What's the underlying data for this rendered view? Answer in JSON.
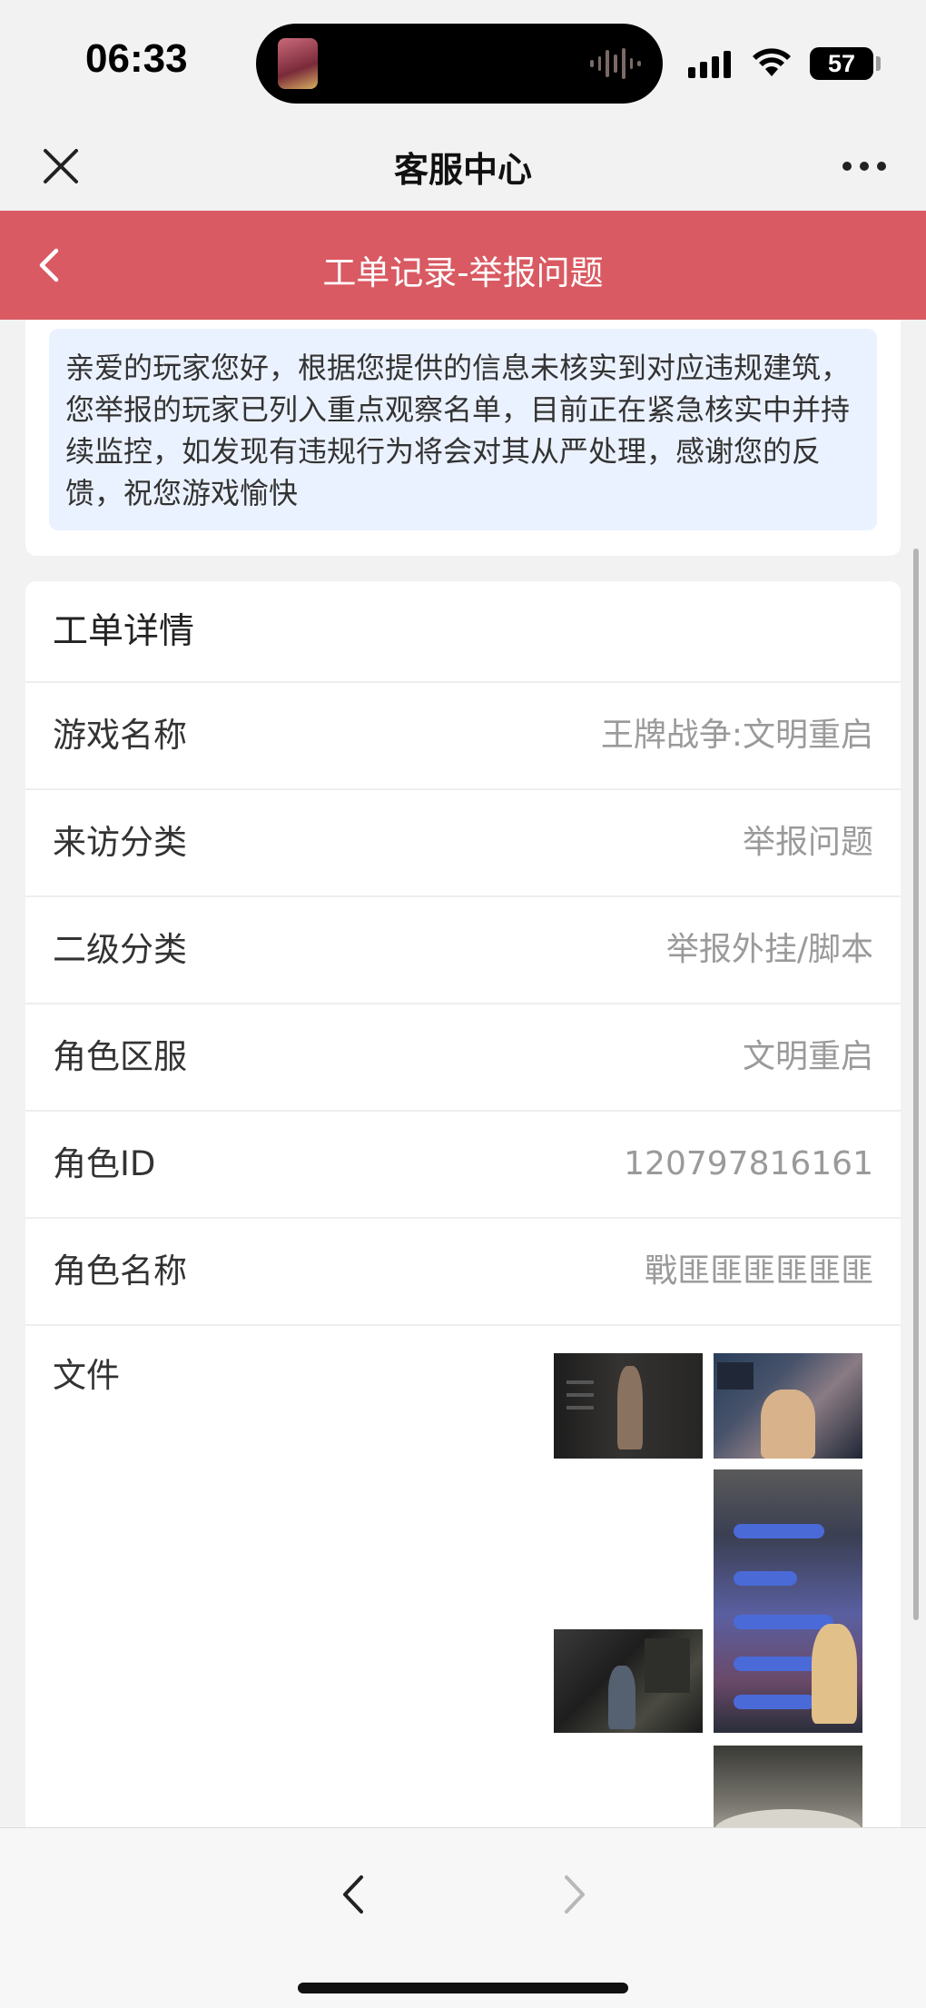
{
  "status_bar": {
    "time": "06:33",
    "battery": "57"
  },
  "wechat_nav": {
    "title": "客服中心",
    "close_icon": "close-icon",
    "more_icon": "more-dots-icon"
  },
  "header": {
    "title": "工单记录-举报问题",
    "back_icon": "chevron-left-icon",
    "color": "#d95a62"
  },
  "reply": {
    "text": "亲爱的玩家您好，根据您提供的信息未核实到对应违规建筑，您举报的玩家已列入重点观察名单，目前正在紧急核实中并持续监控，如发现有违规行为将会对其从严处理，感谢您的反馈，祝您游戏愉快"
  },
  "details": {
    "title": "工单详情",
    "rows": [
      {
        "label": "游戏名称",
        "value": "王牌战争:文明重启"
      },
      {
        "label": "来访分类",
        "value": "举报问题"
      },
      {
        "label": "二级分类",
        "value": "举报外挂/脚本"
      },
      {
        "label": "角色区服",
        "value": "文明重启"
      },
      {
        "label": "角色ID",
        "value": "120797816161"
      },
      {
        "label": "角色名称",
        "value": "戰匪匪匪匪匪匪"
      }
    ],
    "files_label": "文件",
    "file_count_visible": 5
  },
  "bottom_nav": {
    "back_icon": "chevron-left-icon",
    "forward_icon": "chevron-right-icon"
  }
}
